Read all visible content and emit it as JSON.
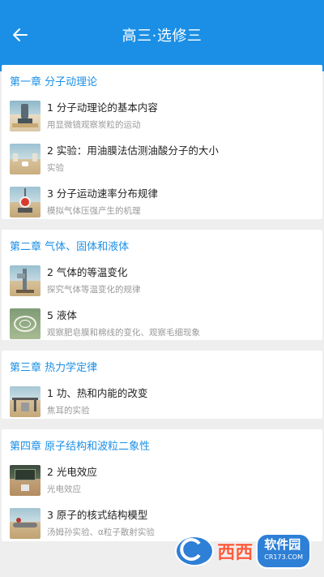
{
  "header": {
    "title": "高三·选修三",
    "back_icon": "arrow-left-icon"
  },
  "chapters": [
    {
      "title": "第一章 分子动理论",
      "lessons": [
        {
          "title": "1 分子动理论的基本内容",
          "subtitle": "用显微镜观察炭粒的运动",
          "thumb": "microscope"
        },
        {
          "title": "2 实验：用油膜法估测油酸分子的大小",
          "subtitle": "实验",
          "thumb": "lab-table"
        },
        {
          "title": "3 分子运动速率分布规律",
          "subtitle": "模拟气体压强产生的机理",
          "thumb": "scale"
        }
      ]
    },
    {
      "title": "第二章 气体、固体和液体",
      "lessons": [
        {
          "title": "2 气体的等温变化",
          "subtitle": "探究气体等温变化的规律",
          "thumb": "gas-apparatus"
        },
        {
          "title": "5 液体",
          "subtitle": "观察肥皂膜和棉线的变化、观察毛细现象",
          "thumb": "soap-film"
        }
      ]
    },
    {
      "title": "第三章 热力学定律",
      "lessons": [
        {
          "title": "1 功、热和内能的改变",
          "subtitle": "焦耳的实验",
          "thumb": "joule"
        }
      ]
    },
    {
      "title": "第四章 原子结构和波粒二象性",
      "lessons": [
        {
          "title": "2 光电效应",
          "subtitle": "光电效应",
          "thumb": "photoelectric"
        },
        {
          "title": "3 原子的核式结构模型",
          "subtitle": "汤姆孙实验、α粒子散射实验",
          "thumb": "rutherford"
        }
      ]
    }
  ],
  "watermark": {
    "brand_red": "西西",
    "brand_box": "软件园",
    "brand_domain": "CR173.COM"
  },
  "colors": {
    "appbar": "#1b8fe6",
    "chapter_title": "#1b8fe6",
    "background": "#eeeeee"
  }
}
